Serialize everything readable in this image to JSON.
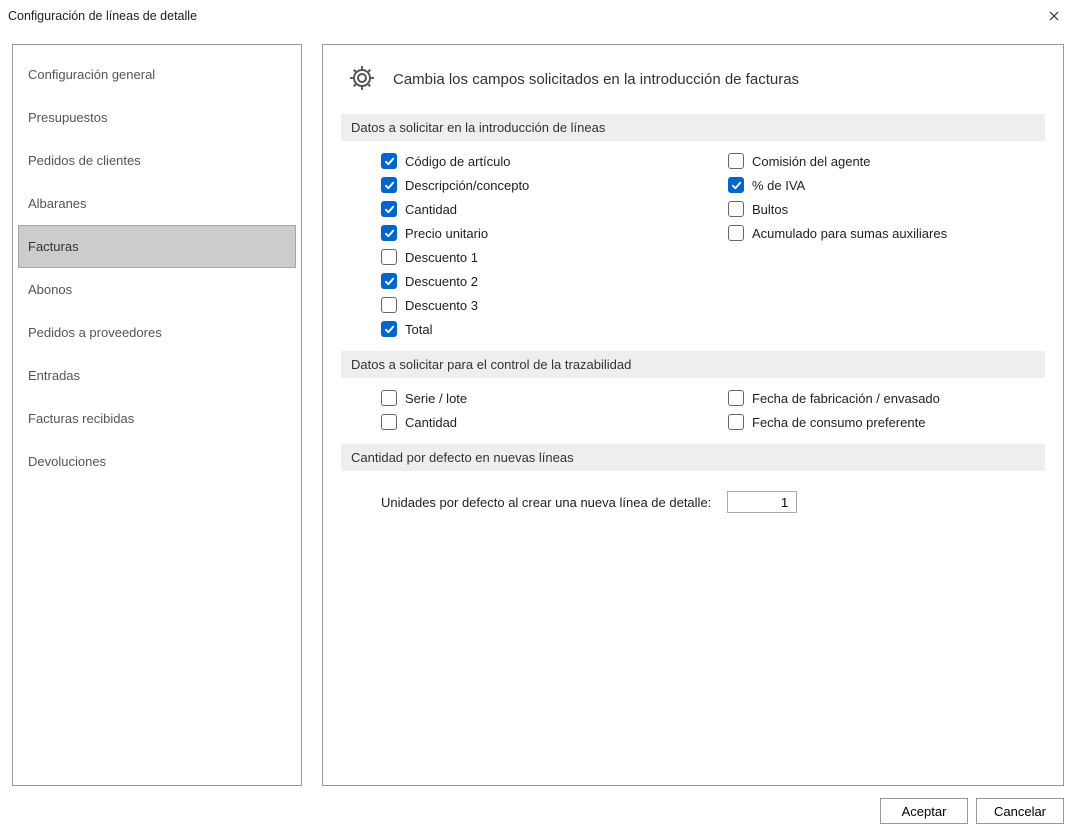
{
  "window": {
    "title": "Configuración de líneas de detalle"
  },
  "sidebar": {
    "items": [
      {
        "label": "Configuración general",
        "selected": false
      },
      {
        "label": "Presupuestos",
        "selected": false
      },
      {
        "label": "Pedidos de clientes",
        "selected": false
      },
      {
        "label": "Albaranes",
        "selected": false
      },
      {
        "label": "Facturas",
        "selected": true
      },
      {
        "label": "Abonos",
        "selected": false
      },
      {
        "label": "Pedidos a proveedores",
        "selected": false
      },
      {
        "label": "Entradas",
        "selected": false
      },
      {
        "label": "Facturas recibidas",
        "selected": false
      },
      {
        "label": "Devoluciones",
        "selected": false
      }
    ]
  },
  "main": {
    "heading": "Cambia los campos solicitados en la introducción de facturas",
    "section1": {
      "title": "Datos a solicitar en la introducción de líneas",
      "left": [
        {
          "label": "Código de artículo",
          "checked": true
        },
        {
          "label": "Descripción/concepto",
          "checked": true
        },
        {
          "label": "Cantidad",
          "checked": true
        },
        {
          "label": "Precio unitario",
          "checked": true
        },
        {
          "label": "Descuento 1",
          "checked": false
        },
        {
          "label": "Descuento 2",
          "checked": true
        },
        {
          "label": "Descuento 3",
          "checked": false
        },
        {
          "label": "Total",
          "checked": true
        }
      ],
      "right": [
        {
          "label": "Comisión del agente",
          "checked": false
        },
        {
          "label": "% de IVA",
          "checked": true
        },
        {
          "label": "Bultos",
          "checked": false
        },
        {
          "label": "Acumulado para sumas auxiliares",
          "checked": false
        }
      ]
    },
    "section2": {
      "title": "Datos a solicitar para el control de la trazabilidad",
      "left": [
        {
          "label": "Serie / lote",
          "checked": false
        },
        {
          "label": "Cantidad",
          "checked": false
        }
      ],
      "right": [
        {
          "label": "Fecha de fabricación / envasado",
          "checked": false
        },
        {
          "label": "Fecha de consumo preferente",
          "checked": false
        }
      ]
    },
    "section3": {
      "title": "Cantidad por defecto en nuevas líneas",
      "field_label": "Unidades por defecto al crear una nueva línea de detalle:",
      "value": "1"
    }
  },
  "footer": {
    "accept": "Aceptar",
    "cancel": "Cancelar"
  }
}
